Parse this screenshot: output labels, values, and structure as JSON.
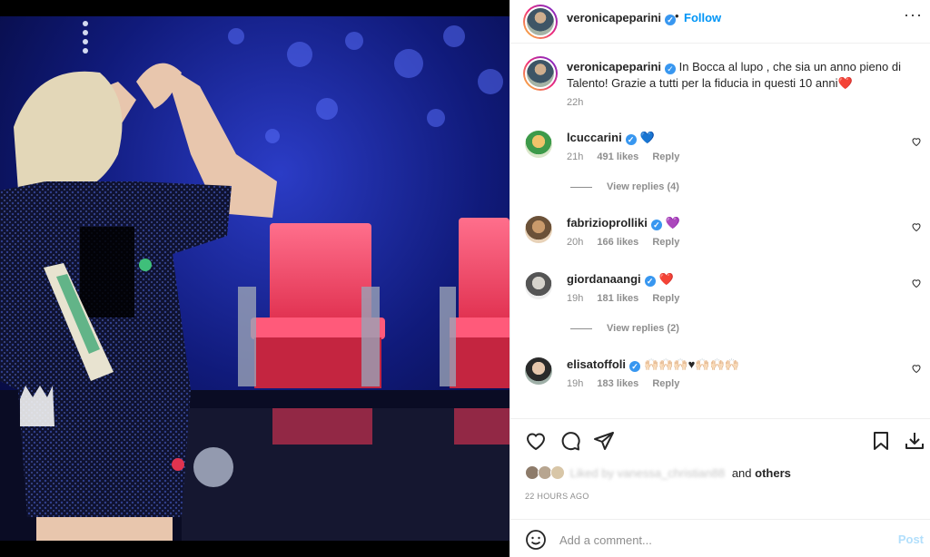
{
  "post": {
    "author": "veronicapeparini",
    "follow_label": "Follow",
    "more_icon": "more-options-icon"
  },
  "caption": {
    "username": "veronicapeparini",
    "text": "In Bocca al lupo , che sia un anno pieno di Talento! Grazie a tutti per la fiducia in questi 10 anni",
    "emoji": "❤️",
    "time": "22h"
  },
  "comments": [
    {
      "username": "lcuccarini",
      "text": "💙",
      "time": "21h",
      "likes": "491 likes",
      "reply_label": "Reply",
      "view_replies": "View replies (4)"
    },
    {
      "username": "fabrizioprolliki",
      "text": "💜",
      "time": "20h",
      "likes": "166 likes",
      "reply_label": "Reply"
    },
    {
      "username": "giordanaangi",
      "text": "❤️",
      "time": "19h",
      "likes": "181 likes",
      "reply_label": "Reply",
      "view_replies": "View replies (2)"
    },
    {
      "username": "elisatoffoli",
      "text": "🙌🏻🙌🏻🙌🏻♥🙌🏻🙌🏻🙌🏻",
      "time": "19h",
      "likes": "183 likes",
      "reply_label": "Reply"
    }
  ],
  "likes_line": {
    "blurred_names": "Liked by vanessa_christian88",
    "and_label": "and",
    "others_label": "others"
  },
  "timestamp": "22 HOURS AGO",
  "add_comment": {
    "placeholder": "Add a comment...",
    "post_label": "Post"
  },
  "colors": {
    "follow": "#0095f6",
    "verified": "#3897f0",
    "post_disabled": "#b2dffc",
    "meta_gray": "#8e8e8e"
  }
}
